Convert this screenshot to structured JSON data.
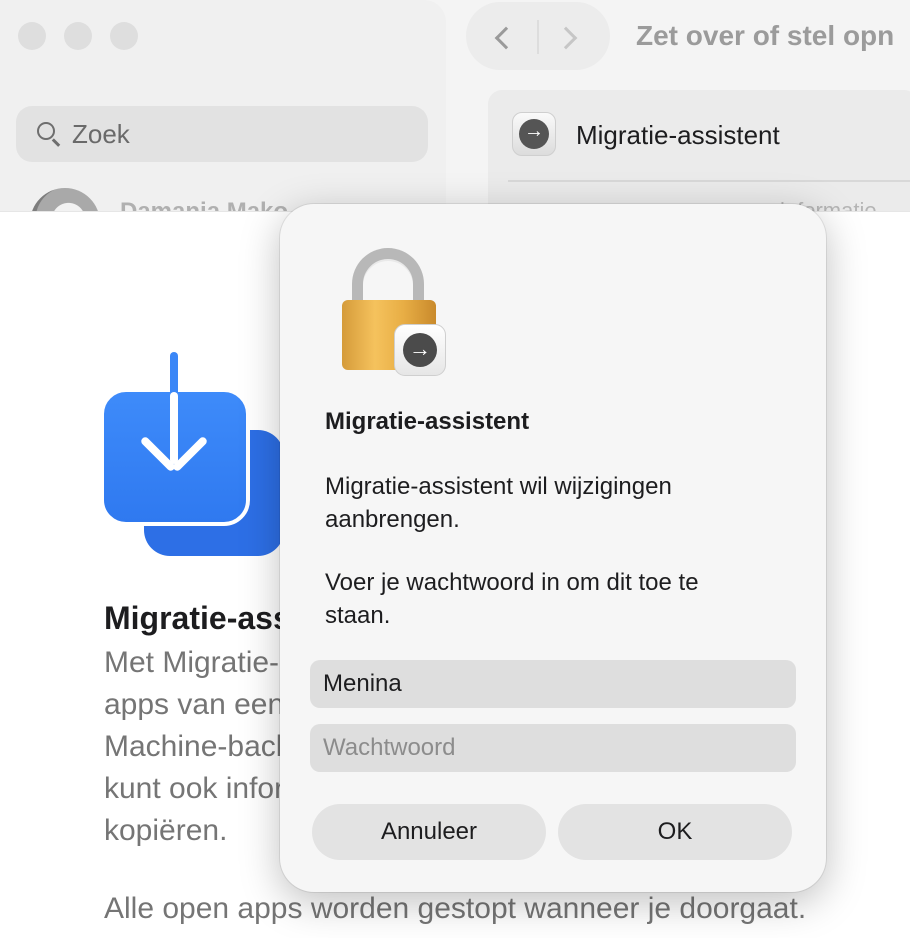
{
  "sidebar": {
    "search_placeholder": "Zoek",
    "user_name": "Damania Mako"
  },
  "header": {
    "title": "Zet over of stel opn"
  },
  "settings_row": {
    "label": "Migratie-assistent",
    "secondary_label": "informatie"
  },
  "main": {
    "title": "Migratie-assistent",
    "description_lines": [
      "Met Migratie-assistent kun je gebruikers, instellingen",
      "apps van een andere Mac of een pc, of van een Time",
      "Machine-backup, naar deze Mac kopiëren. Je",
      "kunt ook informatie naar een andere Mac",
      "kopiëren."
    ],
    "footer": "Alle open apps worden gestopt wanneer je doorgaat."
  },
  "dialog": {
    "title": "Migratie-assistent",
    "message": "Migratie-assistent wil wijzigingen aanbrengen.",
    "prompt": "Voer je wachtwoord in om dit toe te staan.",
    "username_value": "Menina",
    "password_placeholder": "Wachtwoord",
    "cancel_label": "Annuleer",
    "ok_label": "OK"
  },
  "colors": {
    "accent_blue": "#2f79f0",
    "lock_gold": "#e8ae45",
    "dialog_bg": "#f6f6f6"
  },
  "icons": [
    "search-icon",
    "back-chevron-icon",
    "forward-chevron-icon",
    "migration-assistant-icon",
    "lock-icon",
    "migration-download-icon"
  ]
}
